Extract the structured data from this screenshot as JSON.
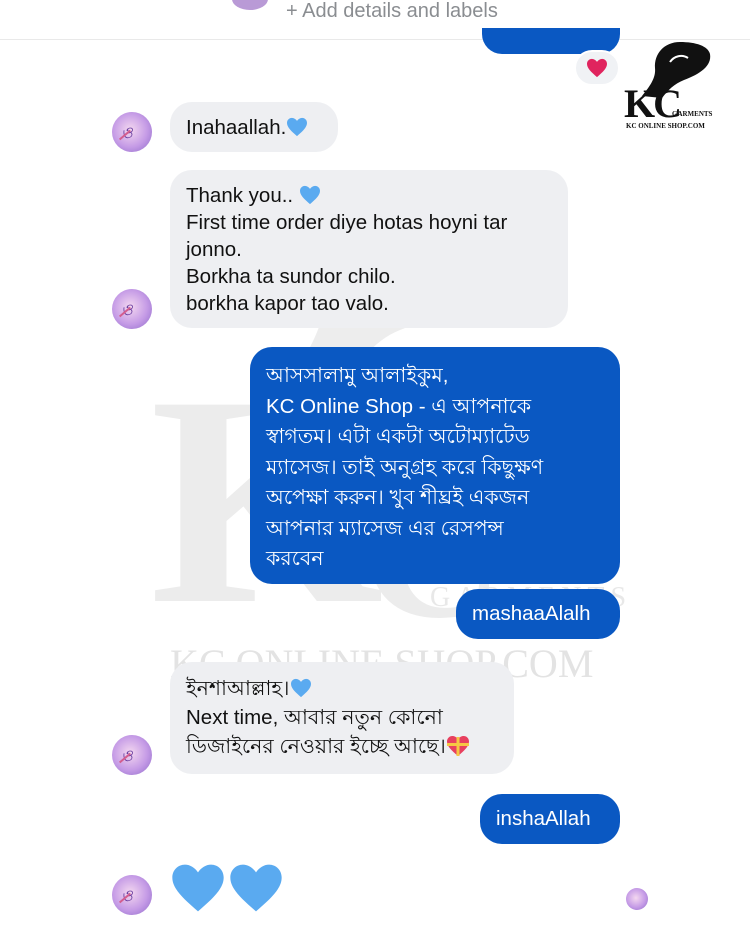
{
  "header": {
    "add_details": "+ Add details and labels"
  },
  "logo": {
    "kc": "KC",
    "garments": "GARMENTS",
    "shop": "KC ONLINE SHOP.COM"
  },
  "watermark": {
    "k": "K",
    "c": "C",
    "garments": "GARMENTS",
    "shop": "KC ONLINE SHOP.COM"
  },
  "messages": [
    {
      "from": "customer",
      "lines": [
        "Inahaallah."
      ],
      "emoji": "blue-heart"
    },
    {
      "from": "customer",
      "lines": [
        "Thank you..",
        "First time order diye hotas hoyni tar",
        "jonno.",
        "Borkha ta sundor chilo.",
        "borkha kapor tao valo."
      ]
    },
    {
      "from": "shop",
      "lines": [
        "আসসালামু আলাইকুম,",
        "KC Online Shop - এ আপনাকে",
        "স্বাগতম। এটা একটা অটোম্যাটেড",
        "ম্যাসেজ। তাই অনুগ্রহ করে কিছুক্ষণ",
        "অপেক্ষা করুন। খুব শীঘ্রই একজন",
        "আপনার ম্যাসেজ এর রেসপন্স",
        "করবেন"
      ]
    },
    {
      "from": "shop",
      "lines": [
        "mashaaAlalh"
      ]
    },
    {
      "from": "customer",
      "lines": [
        "ইনশাআল্লাহ।",
        "Next time, আবার নতুন কোনো",
        "ডিজাইনের নেওয়ার ইচ্ছে আছে।"
      ]
    },
    {
      "from": "shop",
      "lines": [
        "inshaAllah"
      ]
    }
  ],
  "reactions": {
    "heart": "red-heart"
  },
  "colors": {
    "outgoing": "#0a58c2",
    "incoming": "#eeeff2",
    "reaction": "#e0245e",
    "blue_heart": "#5aaaf0"
  },
  "icons": {
    "blue_heart": "blue-heart-icon",
    "red_heart": "red-heart-icon",
    "gift_heart": "heart-with-ribbon-icon"
  }
}
